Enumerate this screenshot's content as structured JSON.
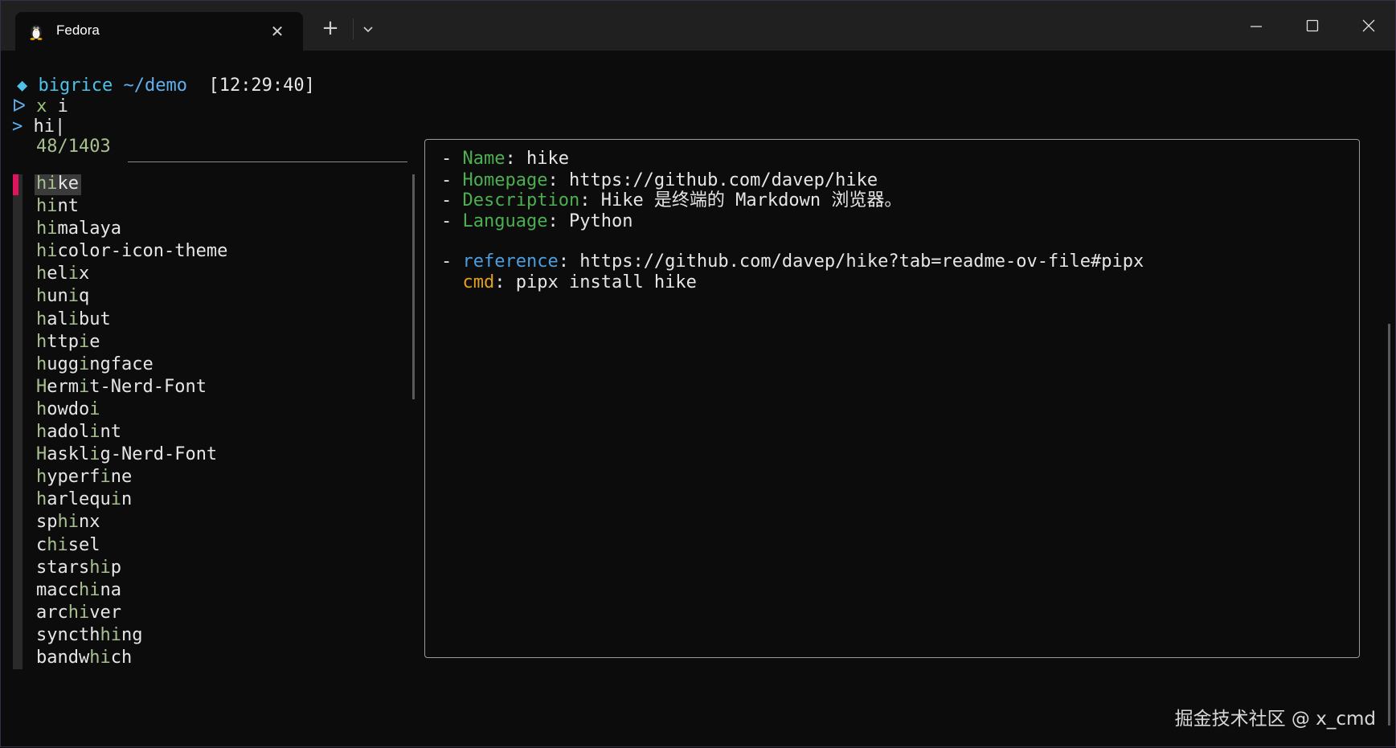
{
  "tab": {
    "title": "Fedora",
    "icon": "tux-penguin-icon"
  },
  "prompt": {
    "diamond": "◆",
    "user": "bigrice",
    "path": "~/demo",
    "time": "[12:29:40]",
    "cmd_marker": "ᐅ",
    "cmd_name": "x",
    "cmd_arg": "i"
  },
  "search": {
    "marker": ">",
    "query": "hi",
    "counter": "48/1403"
  },
  "results": [
    {
      "pre": "",
      "hl": "hi",
      "post": "ke"
    },
    {
      "pre": "",
      "hl": "hi",
      "post": "nt"
    },
    {
      "pre": "",
      "hl": "hi",
      "post": "malaya"
    },
    {
      "pre": "",
      "hl": "hi",
      "post": "color-icon-theme"
    },
    {
      "pre": "",
      "hl": "h",
      "mid": "el",
      "hl2": "i",
      "post": "x"
    },
    {
      "pre": "",
      "hl": "h",
      "mid": "un",
      "hl2": "i",
      "post": "q"
    },
    {
      "pre": "",
      "hl": "h",
      "mid": "al",
      "hl2": "i",
      "post": "but"
    },
    {
      "pre": "",
      "hl": "h",
      "mid": "ttp",
      "hl2": "i",
      "post": "e"
    },
    {
      "pre": "",
      "hl": "h",
      "mid": "ugg",
      "hl2": "i",
      "post": "ngface"
    },
    {
      "pre": "",
      "hl": "H",
      "mid": "erm",
      "hl2": "i",
      "post": "t-Nerd-Font"
    },
    {
      "pre": "",
      "hl": "h",
      "mid": "owdo",
      "hl2": "i",
      "post": ""
    },
    {
      "pre": "",
      "hl": "h",
      "mid": "adol",
      "hl2": "i",
      "post": "nt"
    },
    {
      "pre": "",
      "hl": "H",
      "mid": "askl",
      "hl2": "i",
      "post": "g-Nerd-Font"
    },
    {
      "pre": "",
      "hl": "h",
      "mid": "yperf",
      "hl2": "i",
      "post": "ne"
    },
    {
      "pre": "",
      "hl": "h",
      "mid": "arlequ",
      "hl2": "i",
      "post": "n"
    },
    {
      "pre": "sp",
      "hl": "hi",
      "post": "nx"
    },
    {
      "pre": "c",
      "hl": "hi",
      "post": "sel"
    },
    {
      "pre": "stars",
      "hl": "hi",
      "post": "p"
    },
    {
      "pre": "macc",
      "hl": "hi",
      "post": "na"
    },
    {
      "pre": "arc",
      "hl": "hi",
      "post": "ver"
    },
    {
      "pre": "syncth",
      "hl": "i",
      "post": "ng",
      "hpre": "h"
    },
    {
      "pre": "bandw",
      "hl": "hi",
      "post": "ch"
    }
  ],
  "preview": {
    "dash": "-",
    "name_key": "Name",
    "name_val": "hike",
    "homepage_key": "Homepage",
    "homepage_val": "https://github.com/davep/hike",
    "description_key": "Description",
    "description_val": "Hike 是终端的 Markdown 浏览器。",
    "language_key": "Language",
    "language_val": "Python",
    "reference_key": "reference",
    "reference_val": "https://github.com/davep/hike?tab=readme-ov-file#pipx",
    "cmd_key": "cmd",
    "cmd_val": "pipx install hike",
    "colon": ": "
  },
  "watermark": "掘金技术社区 @ x_cmd",
  "colors": {
    "selection_marker": "#e0145e",
    "match_highlight": "#a8c090",
    "key_green": "#4caf50",
    "key_blue": "#4a9fe0",
    "key_yellow": "#e0a020"
  }
}
